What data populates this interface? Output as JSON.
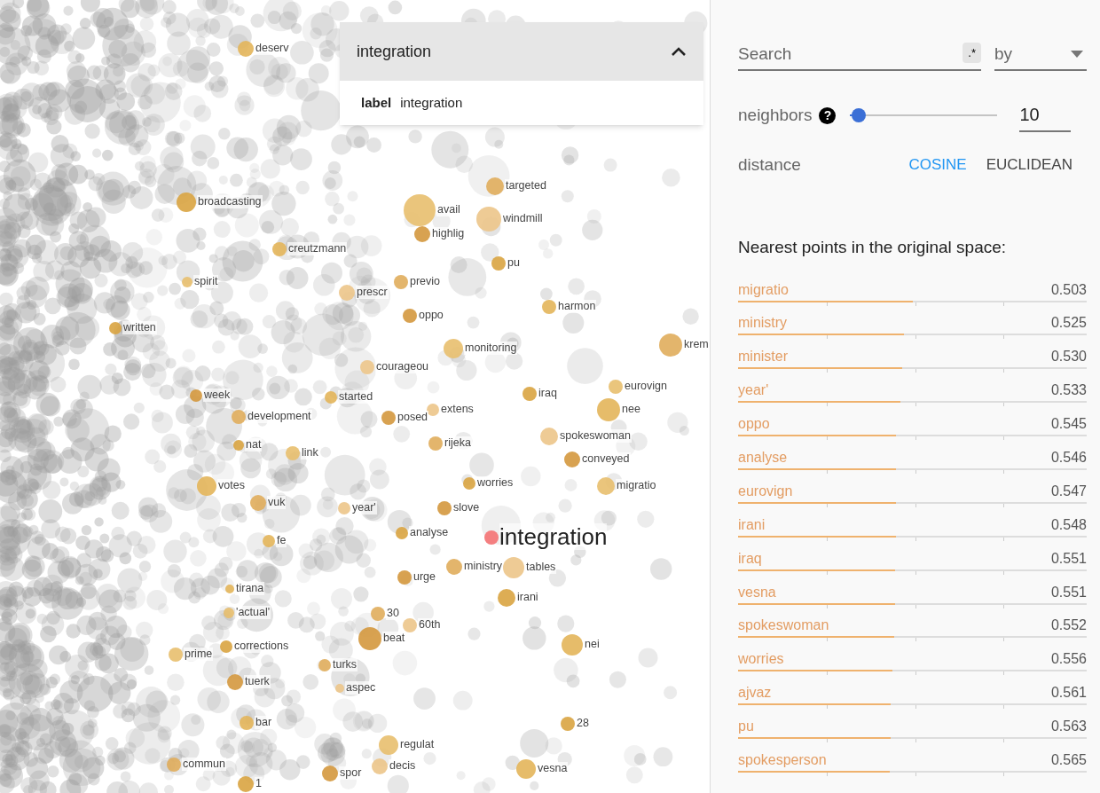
{
  "points": [
    {
      "label": "deserv",
      "selected": false
    },
    {
      "label": "broadcasting",
      "selected": false
    },
    {
      "label": "avail",
      "selected": false
    },
    {
      "label": "targeted",
      "selected": false
    },
    {
      "label": "windmill",
      "selected": false
    },
    {
      "label": "highlig",
      "selected": false
    },
    {
      "label": "creutzmann",
      "selected": false
    },
    {
      "label": "pu",
      "selected": false
    },
    {
      "label": "spirit",
      "selected": false
    },
    {
      "label": "previo",
      "selected": false
    },
    {
      "label": "prescr",
      "selected": false
    },
    {
      "label": "oppo",
      "selected": false
    },
    {
      "label": "harmon",
      "selected": false
    },
    {
      "label": "written",
      "selected": false
    },
    {
      "label": "monitoring",
      "selected": false
    },
    {
      "label": "krem",
      "selected": false
    },
    {
      "label": "courageou",
      "selected": false
    },
    {
      "label": "week",
      "selected": false
    },
    {
      "label": "started",
      "selected": false
    },
    {
      "label": "iraq",
      "selected": false
    },
    {
      "label": "eurovign",
      "selected": false
    },
    {
      "label": "development",
      "selected": false
    },
    {
      "label": "extens",
      "selected": false
    },
    {
      "label": "posed",
      "selected": false
    },
    {
      "label": "nee",
      "selected": false
    },
    {
      "label": "nat",
      "selected": false
    },
    {
      "label": "link",
      "selected": false
    },
    {
      "label": "rijeka",
      "selected": false
    },
    {
      "label": "spokeswoman",
      "selected": false
    },
    {
      "label": "conveyed",
      "selected": false
    },
    {
      "label": "votes",
      "selected": false
    },
    {
      "label": "worries",
      "selected": false
    },
    {
      "label": "migratio",
      "selected": false
    },
    {
      "label": "vuk",
      "selected": false
    },
    {
      "label": "year'",
      "selected": false
    },
    {
      "label": "slove",
      "selected": false
    },
    {
      "label": "fe",
      "selected": false
    },
    {
      "label": "analyse",
      "selected": false
    },
    {
      "label": "integration",
      "selected": true
    },
    {
      "label": "ministry",
      "selected": false
    },
    {
      "label": "tables",
      "selected": false
    },
    {
      "label": "urge",
      "selected": false
    },
    {
      "label": "tirana",
      "selected": false
    },
    {
      "label": "irani",
      "selected": false
    },
    {
      "label": "'actual'",
      "selected": false
    },
    {
      "label": "30",
      "selected": false
    },
    {
      "label": "60th",
      "selected": false
    },
    {
      "label": "beat",
      "selected": false
    },
    {
      "label": "nei",
      "selected": false
    },
    {
      "label": "corrections",
      "selected": false
    },
    {
      "label": "prime",
      "selected": false
    },
    {
      "label": "turks",
      "selected": false
    },
    {
      "label": "aspec",
      "selected": false
    },
    {
      "label": "tuerk",
      "selected": false
    },
    {
      "label": "bar",
      "selected": false
    },
    {
      "label": "28",
      "selected": false
    },
    {
      "label": "regulat",
      "selected": false
    },
    {
      "label": "commun",
      "selected": false
    },
    {
      "label": "decis",
      "selected": false
    },
    {
      "label": "spor",
      "selected": false
    },
    {
      "label": "vesna",
      "selected": false
    },
    {
      "label": "1",
      "selected": false
    }
  ],
  "selection_card": {
    "title": "integration",
    "field_name": "label",
    "field_value": "integration"
  },
  "panel": {
    "search": {
      "placeholder": "Search",
      "regex_button": ".*",
      "by_placeholder": "by"
    },
    "neighbors": {
      "label": "neighbors",
      "help": "?",
      "level": 0.06,
      "value": "10"
    },
    "distance": {
      "label": "distance",
      "options": [
        {
          "label": "COSINE",
          "selected": true
        },
        {
          "label": "EUCLIDEAN",
          "selected": false
        }
      ]
    },
    "nearest": {
      "title": "Nearest points in the original space:",
      "rows": [
        {
          "label": "migratio",
          "value": "0.503",
          "level": 0.5
        },
        {
          "label": "ministry",
          "value": "0.525",
          "level": 0.475
        },
        {
          "label": "minister",
          "value": "0.530",
          "level": 0.47
        },
        {
          "label": "year'",
          "value": "0.533",
          "level": 0.465
        },
        {
          "label": "oppo",
          "value": "0.545",
          "level": 0.454
        },
        {
          "label": "analyse",
          "value": "0.546",
          "level": 0.453
        },
        {
          "label": "eurovign",
          "value": "0.547",
          "level": 0.452
        },
        {
          "label": "irani",
          "value": "0.548",
          "level": 0.452
        },
        {
          "label": "iraq",
          "value": "0.551",
          "level": 0.45
        },
        {
          "label": "vesna",
          "value": "0.551",
          "level": 0.45
        },
        {
          "label": "spokeswoman",
          "value": "0.552",
          "level": 0.449
        },
        {
          "label": "worries",
          "value": "0.556",
          "level": 0.443
        },
        {
          "label": "ajvaz",
          "value": "0.561",
          "level": 0.438
        },
        {
          "label": "pu",
          "value": "0.563",
          "level": 0.437
        },
        {
          "label": "spokesperson",
          "value": "0.565",
          "level": 0.434
        }
      ]
    }
  }
}
